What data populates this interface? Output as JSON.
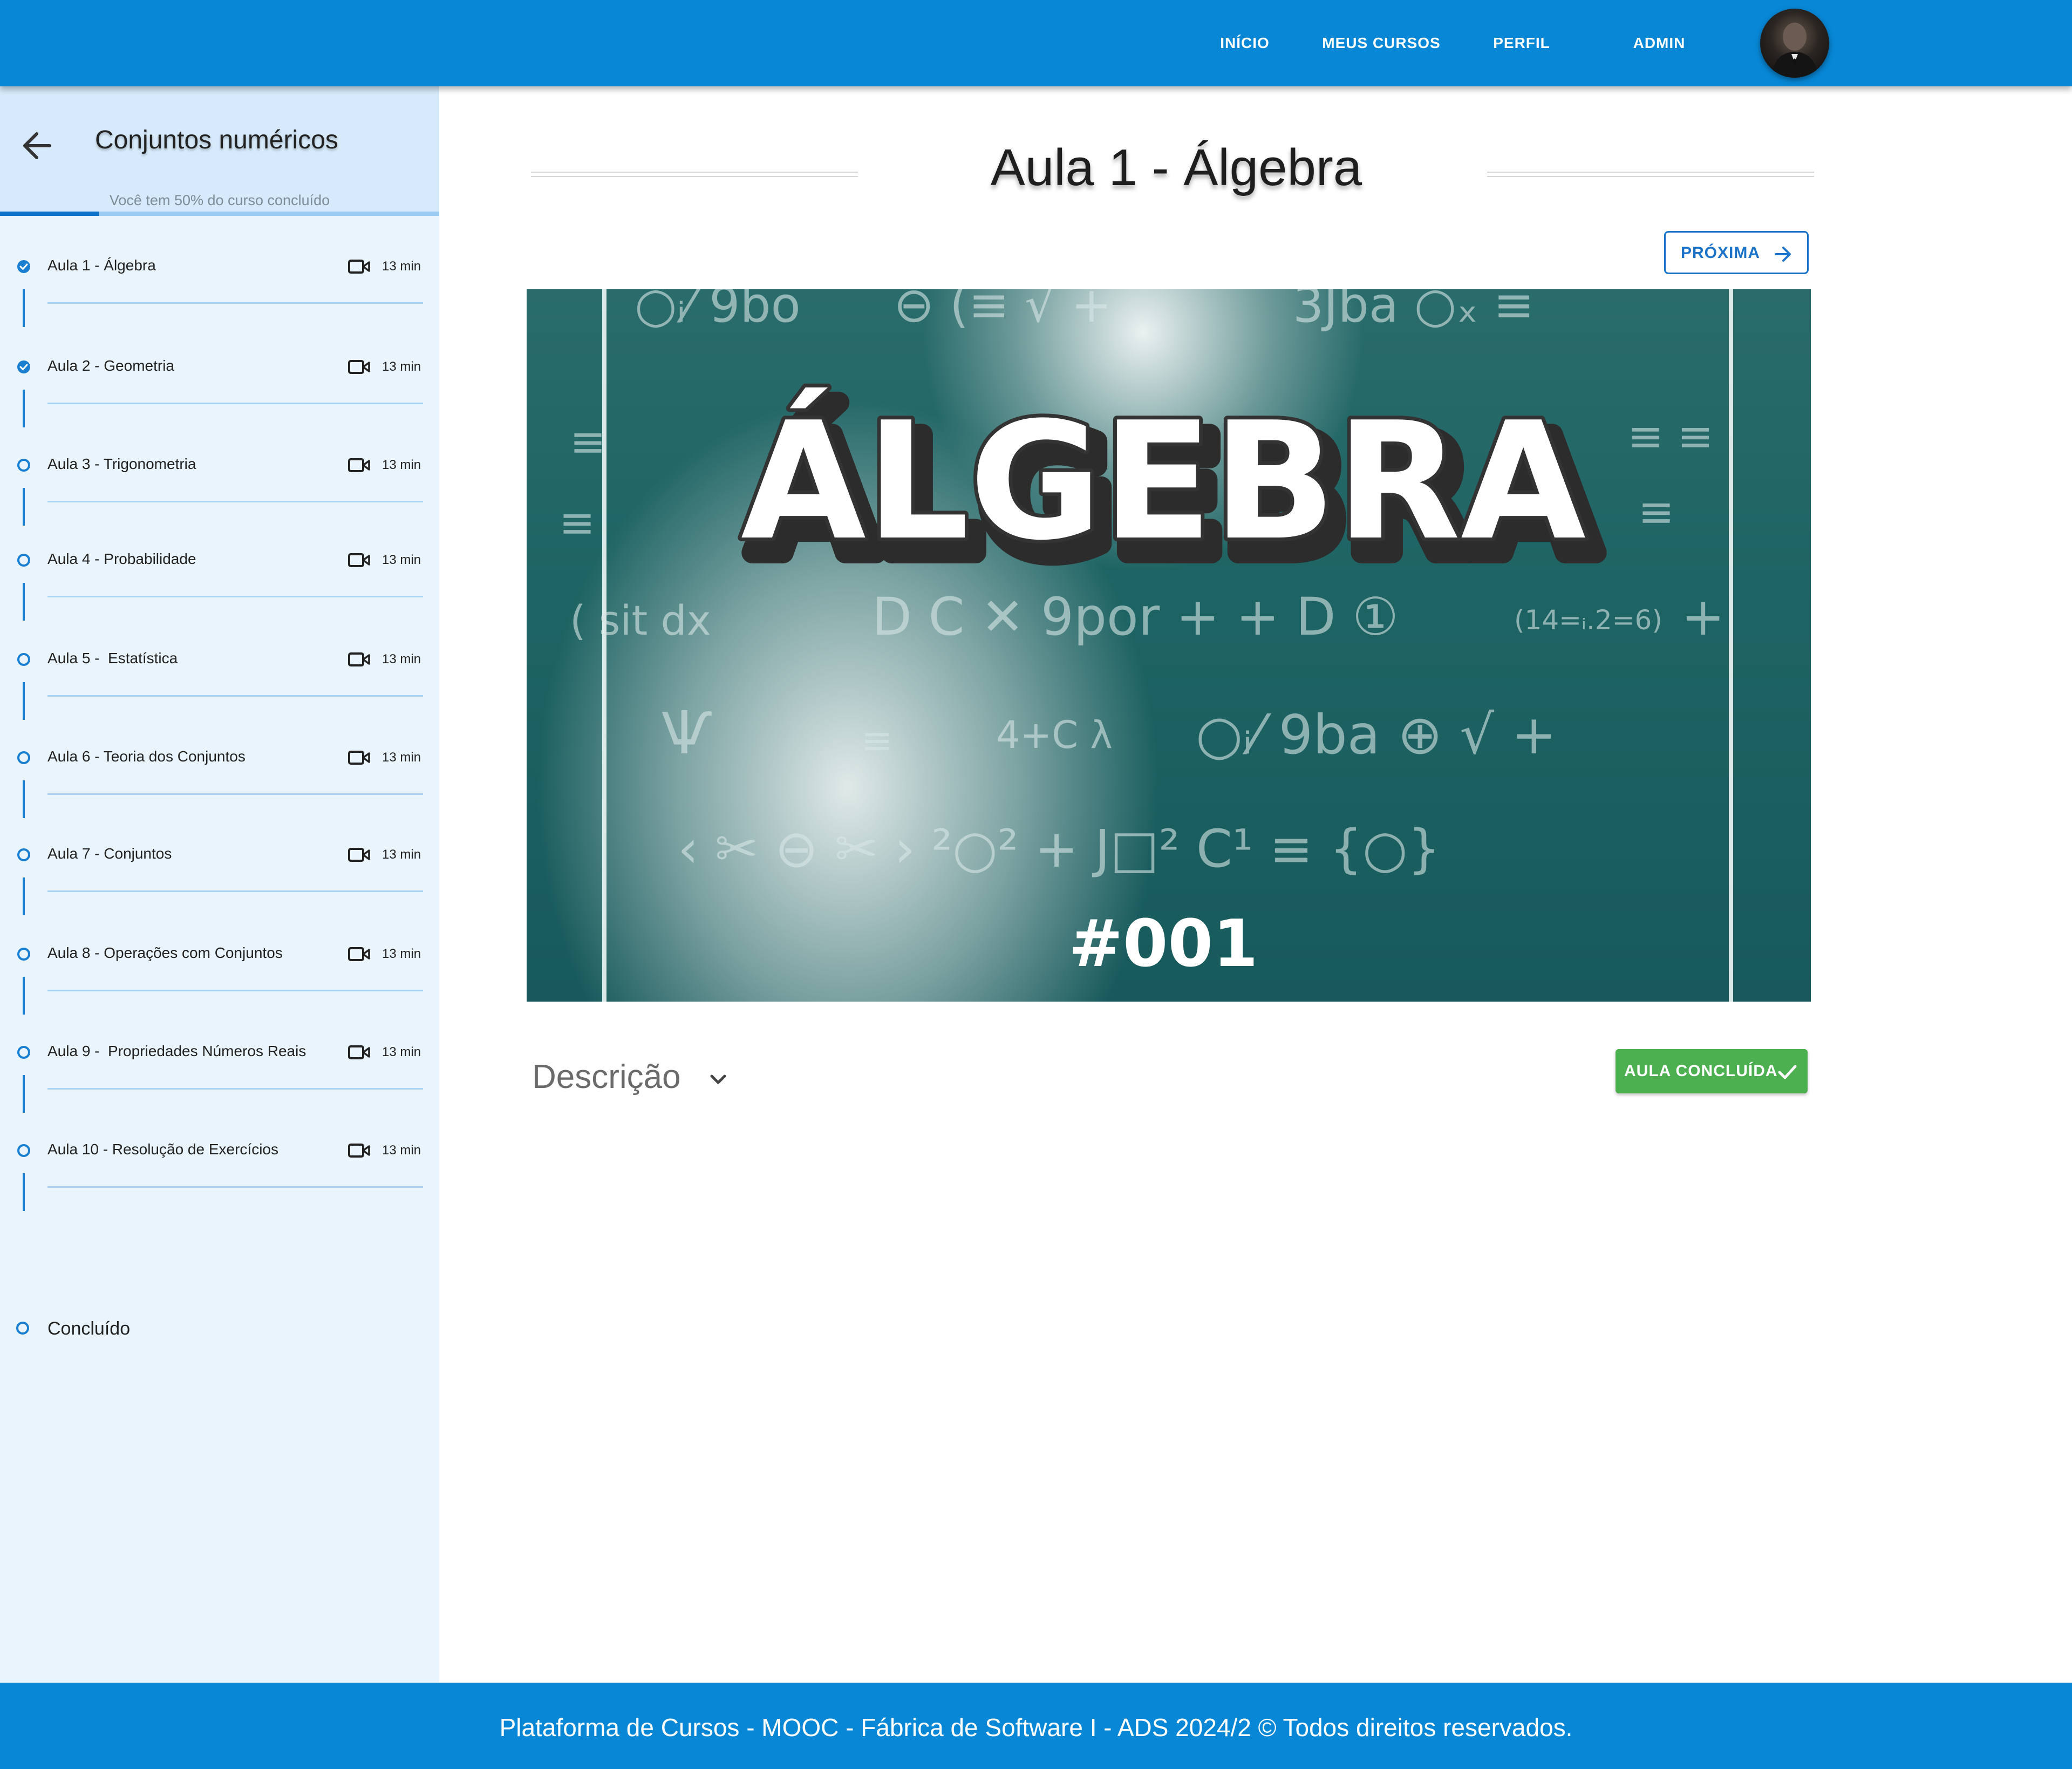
{
  "nav": {
    "items": [
      "INÍCIO",
      "MEUS CURSOS",
      "PERFIL",
      "ADMIN"
    ],
    "avatar_icon": "user-avatar"
  },
  "sidebar": {
    "back_icon": "arrow-left-icon",
    "course_title": "Conjuntos numéricos",
    "progress_text": "Você tem 50% do curso concluído",
    "progress_fraction": 0.5,
    "lessons": [
      {
        "label": "Aula 1 - Álgebra",
        "duration": "13 min",
        "completed": true
      },
      {
        "label": "Aula 2 - Geometria",
        "duration": "13 min",
        "completed": true
      },
      {
        "label": "Aula 3 - Trigonometria",
        "duration": "13 min",
        "completed": false
      },
      {
        "label": "Aula 4 - Probabilidade",
        "duration": "13 min",
        "completed": false
      },
      {
        "label": "Aula 5 -  Estatística",
        "duration": "13 min",
        "completed": false
      },
      {
        "label": "Aula 6 - Teoria dos Conjuntos",
        "duration": "13 min",
        "completed": false
      },
      {
        "label": "Aula 7 - Conjuntos",
        "duration": "13 min",
        "completed": false
      },
      {
        "label": "Aula 8 - Operações com Conjuntos",
        "duration": "13 min",
        "completed": false
      },
      {
        "label": "Aula 9 -  Propriedades Números Reais",
        "duration": "13 min",
        "completed": false
      },
      {
        "label": "Aula 10 - Resolução de Exercícios",
        "duration": "13 min",
        "completed": false
      }
    ],
    "final_label": "Concluído"
  },
  "main": {
    "title": "Aula 1 - Álgebra",
    "next_label": "PRÓXIMA",
    "video": {
      "title_text": "ÁLGEBRA",
      "episode": "#001"
    },
    "description_label": "Descrição",
    "done_label": "AULA CONCLUÍDA"
  },
  "footer": {
    "text": "Plataforma de Cursos - MOOC - Fábrica de Software I - ADS 2024/2  ©  Todos direitos reservados."
  },
  "colors": {
    "primary": "#0887d6",
    "sidebar_bg": "#e9f4fc",
    "success": "#4caf50",
    "accent_blue": "#1a73c8"
  }
}
